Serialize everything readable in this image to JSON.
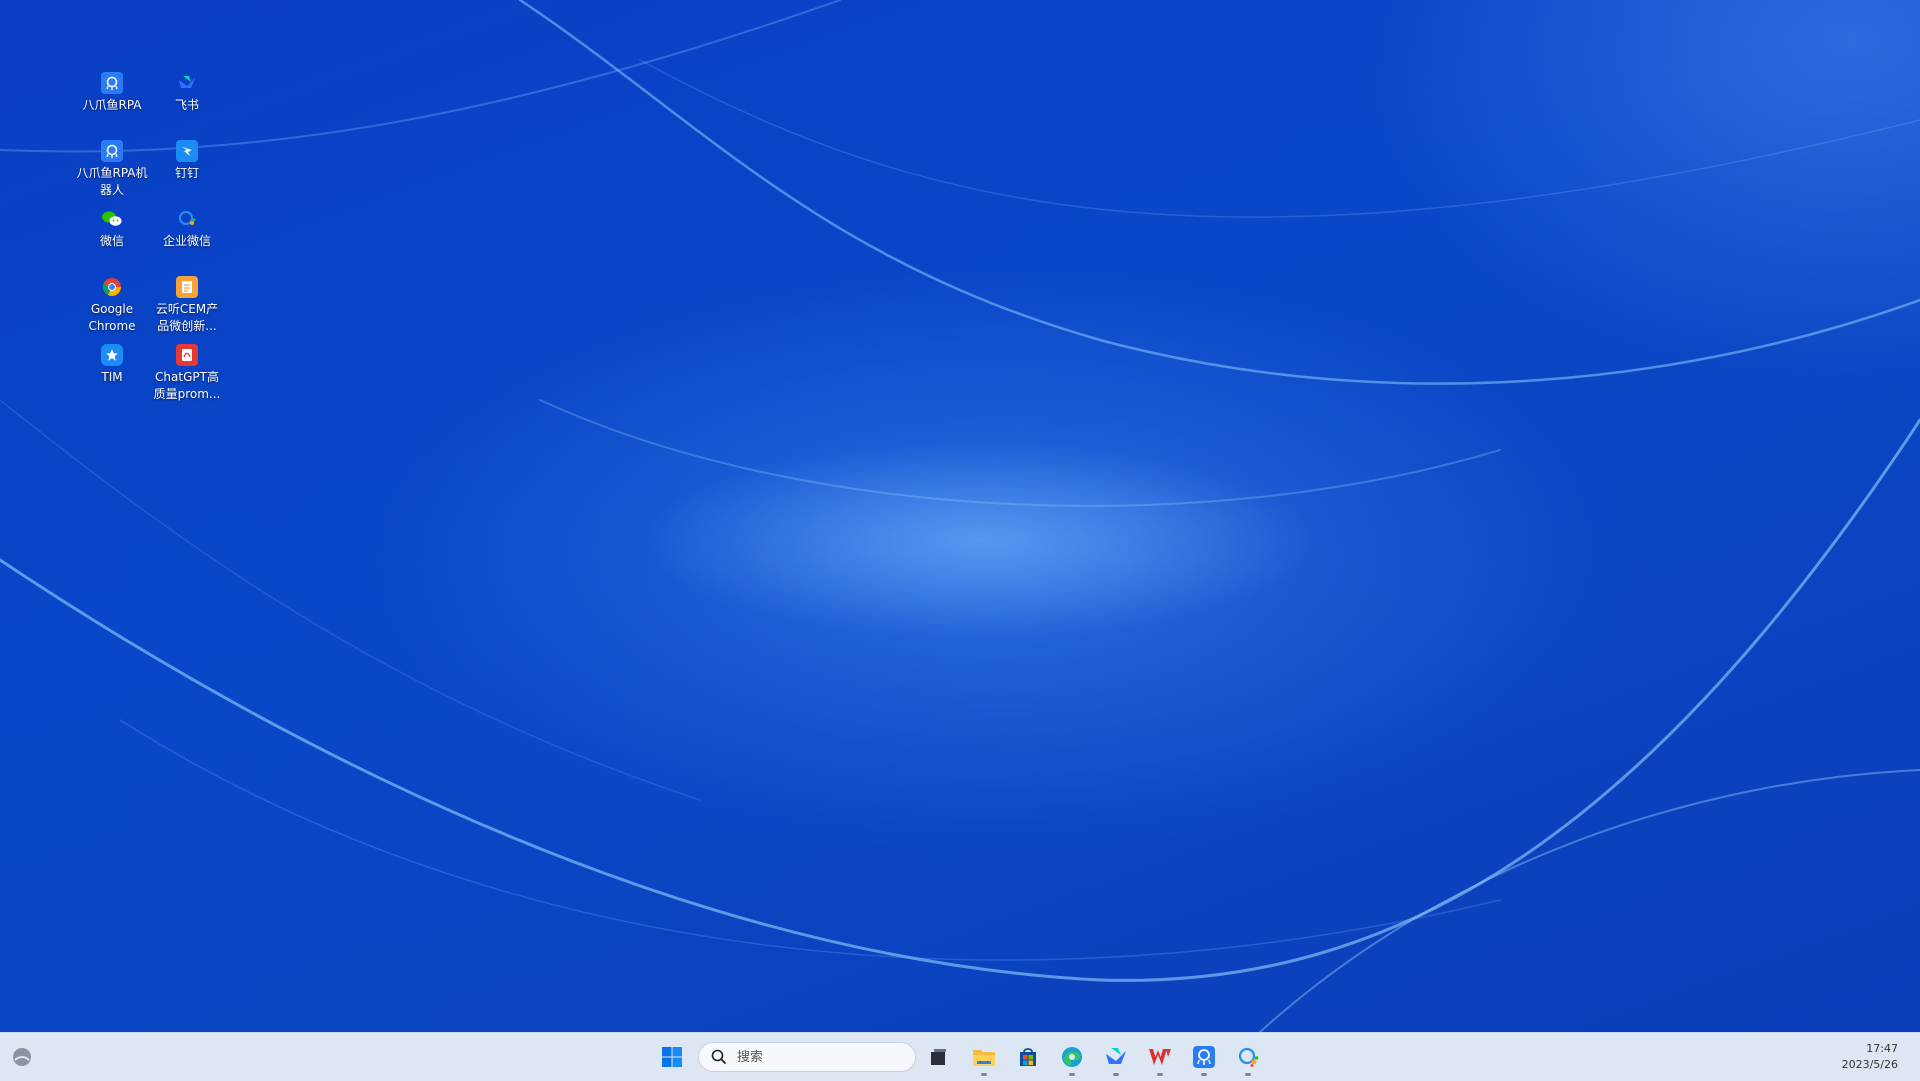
{
  "desktop": {
    "icons": [
      {
        "label": "八爪鱼RPA",
        "icon": "octopus-rpa-icon"
      },
      {
        "label": "飞书",
        "icon": "feishu-icon"
      },
      {
        "label": "八爪鱼RPA机\n器人",
        "icon": "octopus-rpa-robot-icon"
      },
      {
        "label": "钉钉",
        "icon": "dingtalk-icon"
      },
      {
        "label": "微信",
        "icon": "wechat-icon"
      },
      {
        "label": "企业微信",
        "icon": "wecom-icon"
      },
      {
        "label": "Google\nChrome",
        "icon": "chrome-icon"
      },
      {
        "label": "云听CEM产\n品微创新...",
        "icon": "document-icon"
      },
      {
        "label": "TIM",
        "icon": "tim-icon"
      },
      {
        "label": "ChatGPT高\n质量prom...",
        "icon": "pdf-icon"
      }
    ]
  },
  "taskbar": {
    "search_placeholder": "搜索",
    "items": [
      "start-icon",
      "task-view-icon",
      "file-explorer-icon",
      "ms-store-icon",
      "edge-icon",
      "feishu-icon",
      "wps-icon",
      "octopus-rpa-icon",
      "wecom-icon"
    ],
    "clock_time": "17:47",
    "clock_date": "2023/5/26"
  },
  "colors": {
    "wallpaper": "#0a44c0",
    "taskbar": "#dde6f3"
  }
}
